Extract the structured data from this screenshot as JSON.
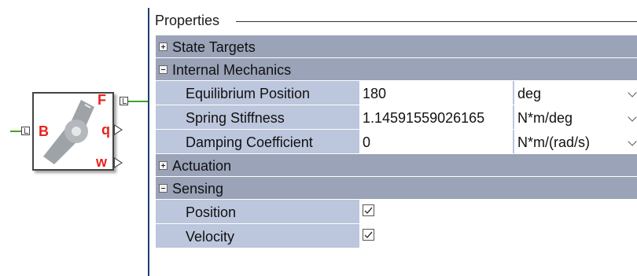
{
  "block": {
    "icon": "rotational-spring-joint-icon",
    "ports": {
      "b": "B",
      "f": "F",
      "q": "q",
      "w": "w"
    },
    "colors": {
      "wire": "#47a12f",
      "port_label": "#e8231c",
      "arm": "#9ea3a7"
    }
  },
  "properties": {
    "title": "Properties",
    "groups": [
      {
        "label": "State Targets",
        "expanded": false
      },
      {
        "label": "Internal Mechanics",
        "expanded": true,
        "rows": [
          {
            "label": "Equilibrium Position",
            "value": "180",
            "unit": "deg"
          },
          {
            "label": "Spring Stiffness",
            "value": "1.14591559026165",
            "unit": "N*m/deg"
          },
          {
            "label": "Damping Coefficient",
            "value": "0",
            "unit": "N*m/(rad/s)"
          }
        ]
      },
      {
        "label": "Actuation",
        "expanded": false
      },
      {
        "label": "Sensing",
        "expanded": true,
        "checks": [
          {
            "label": "Position",
            "checked": true
          },
          {
            "label": "Velocity",
            "checked": true
          }
        ]
      }
    ],
    "colors": {
      "group_bg": "#9aa3b8",
      "row_bg": "#bcc6dc",
      "cell_bg": "#ffffff"
    }
  }
}
